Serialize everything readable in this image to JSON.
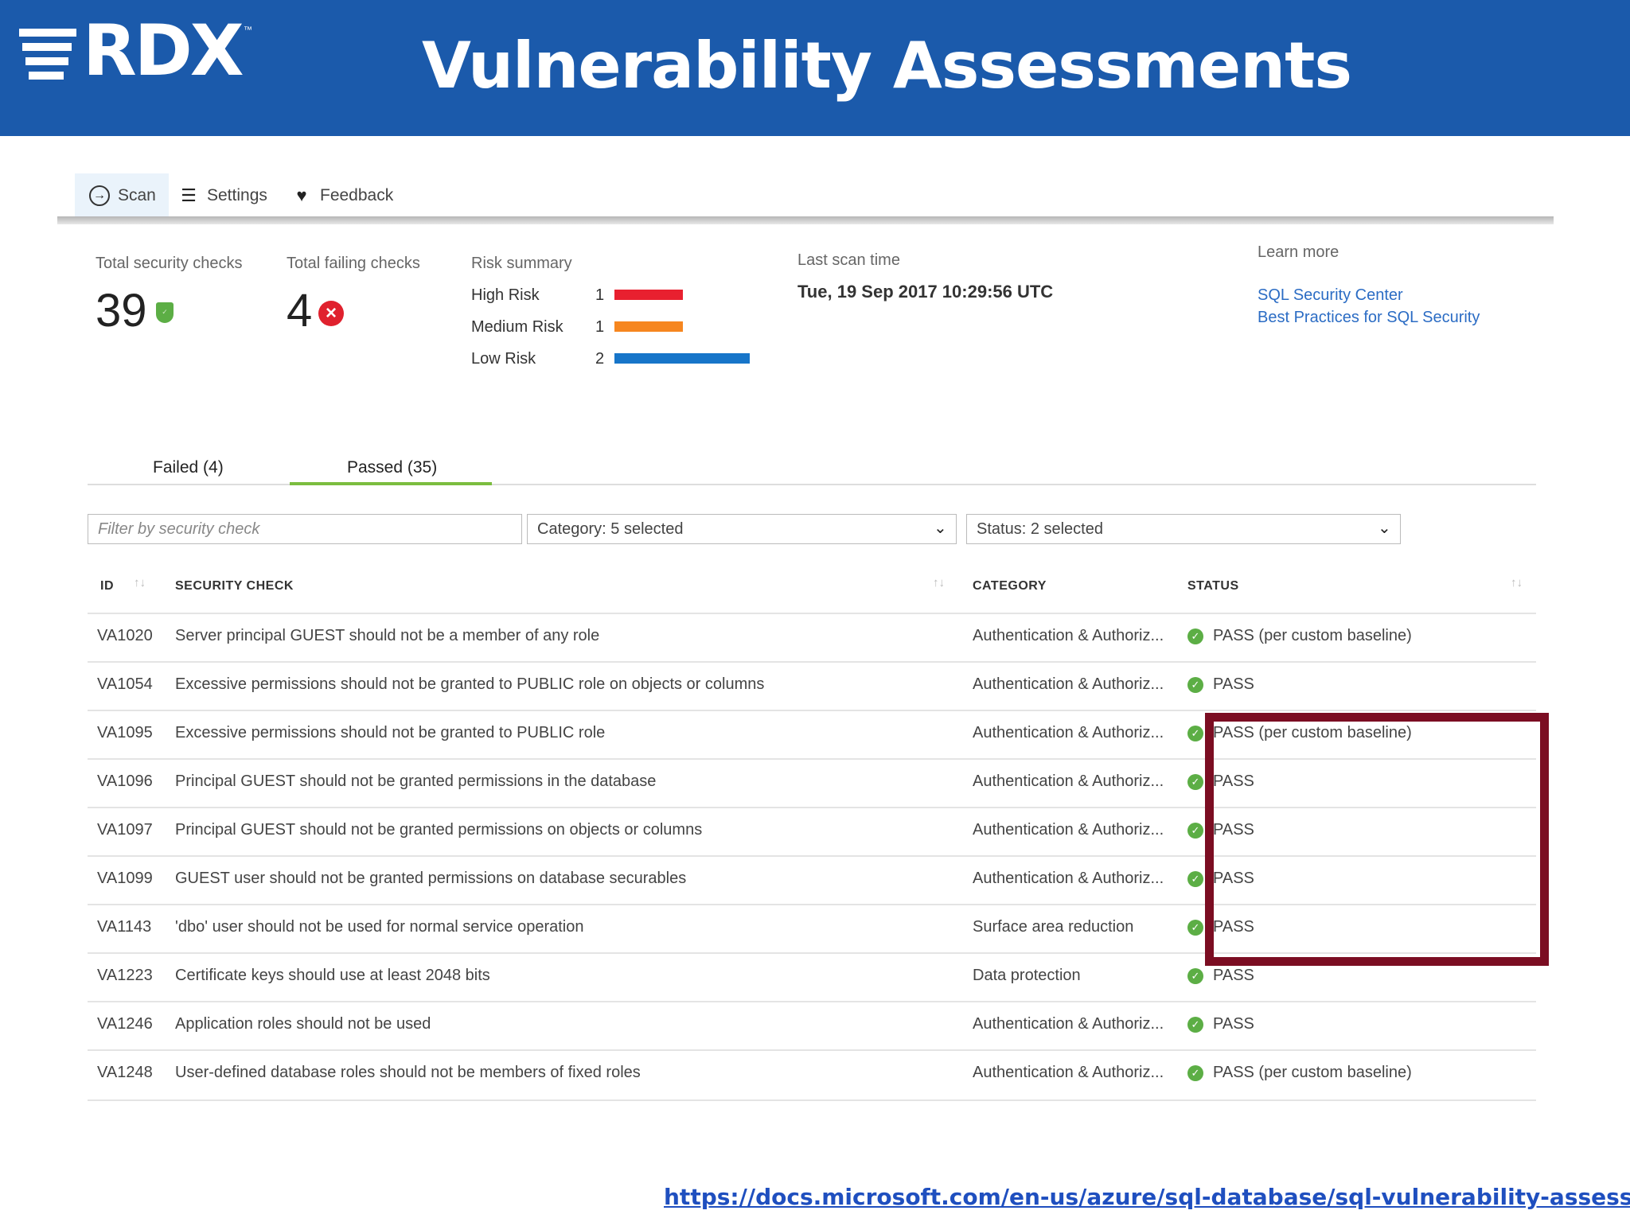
{
  "slide": {
    "title": "Vulnerability Assessments",
    "logo_text": "RDX",
    "logo_tm": "™",
    "source_url": "https://docs.microsoft.com/en-us/azure/sql-database/sql-vulnerability-assessment",
    "banner_color": "#1b5aab",
    "highlight_color": "#7b0d22"
  },
  "toolbar": {
    "scan_label": "Scan",
    "settings_label": "Settings",
    "feedback_label": "Feedback"
  },
  "summary": {
    "total_checks_label": "Total security checks",
    "total_checks_value": "39",
    "failing_checks_label": "Total failing checks",
    "failing_checks_value": "4",
    "risk_summary_label": "Risk summary",
    "risks": [
      {
        "name": "High Risk",
        "count": "1",
        "color": "#e8202f"
      },
      {
        "name": "Medium Risk",
        "count": "1",
        "color": "#f6861f"
      },
      {
        "name": "Low Risk",
        "count": "2",
        "color": "#1775c9"
      }
    ],
    "last_scan_label": "Last scan time",
    "last_scan_value": "Tue, 19 Sep 2017 10:29:56 UTC",
    "learn_more_label": "Learn more",
    "learn_more_links": [
      "SQL Security Center",
      "Best Practices for SQL Security"
    ]
  },
  "tabs": {
    "failed": "Failed (4)",
    "passed": "Passed (35)",
    "selected": "passed"
  },
  "filters": {
    "search_placeholder": "Filter by security check",
    "category": "Category: 5 selected",
    "status": "Status: 2 selected"
  },
  "table": {
    "headers": {
      "id": "ID",
      "check": "SECURITY CHECK",
      "category": "CATEGORY",
      "status": "STATUS"
    },
    "rows": [
      {
        "id": "VA1020",
        "check": "Server principal GUEST should not be a member of any role",
        "category": "Authentication & Authoriz...",
        "status": "PASS (per custom baseline)"
      },
      {
        "id": "VA1054",
        "check": "Excessive permissions should not be granted to PUBLIC role on objects or columns",
        "category": "Authentication & Authoriz...",
        "status": "PASS"
      },
      {
        "id": "VA1095",
        "check": "Excessive permissions should not be granted to PUBLIC role",
        "category": "Authentication & Authoriz...",
        "status": "PASS (per custom baseline)"
      },
      {
        "id": "VA1096",
        "check": "Principal GUEST should not be granted permissions in the database",
        "category": "Authentication & Authoriz...",
        "status": "PASS"
      },
      {
        "id": "VA1097",
        "check": "Principal GUEST should not be granted permissions on objects or columns",
        "category": "Authentication & Authoriz...",
        "status": "PASS"
      },
      {
        "id": "VA1099",
        "check": "GUEST user should not be granted permissions on database securables",
        "category": "Authentication & Authoriz...",
        "status": "PASS"
      },
      {
        "id": "VA1143",
        "check": "'dbo' user should not be used for normal service operation",
        "category": "Surface area reduction",
        "status": "PASS"
      },
      {
        "id": "VA1223",
        "check": "Certificate keys should use at least 2048 bits",
        "category": "Data protection",
        "status": "PASS"
      },
      {
        "id": "VA1246",
        "check": "Application roles should not be used",
        "category": "Authentication & Authoriz...",
        "status": "PASS"
      },
      {
        "id": "VA1248",
        "check": "User-defined database roles should not be members of fixed roles",
        "category": "Authentication & Authoriz...",
        "status": "PASS (per custom baseline)"
      }
    ]
  }
}
